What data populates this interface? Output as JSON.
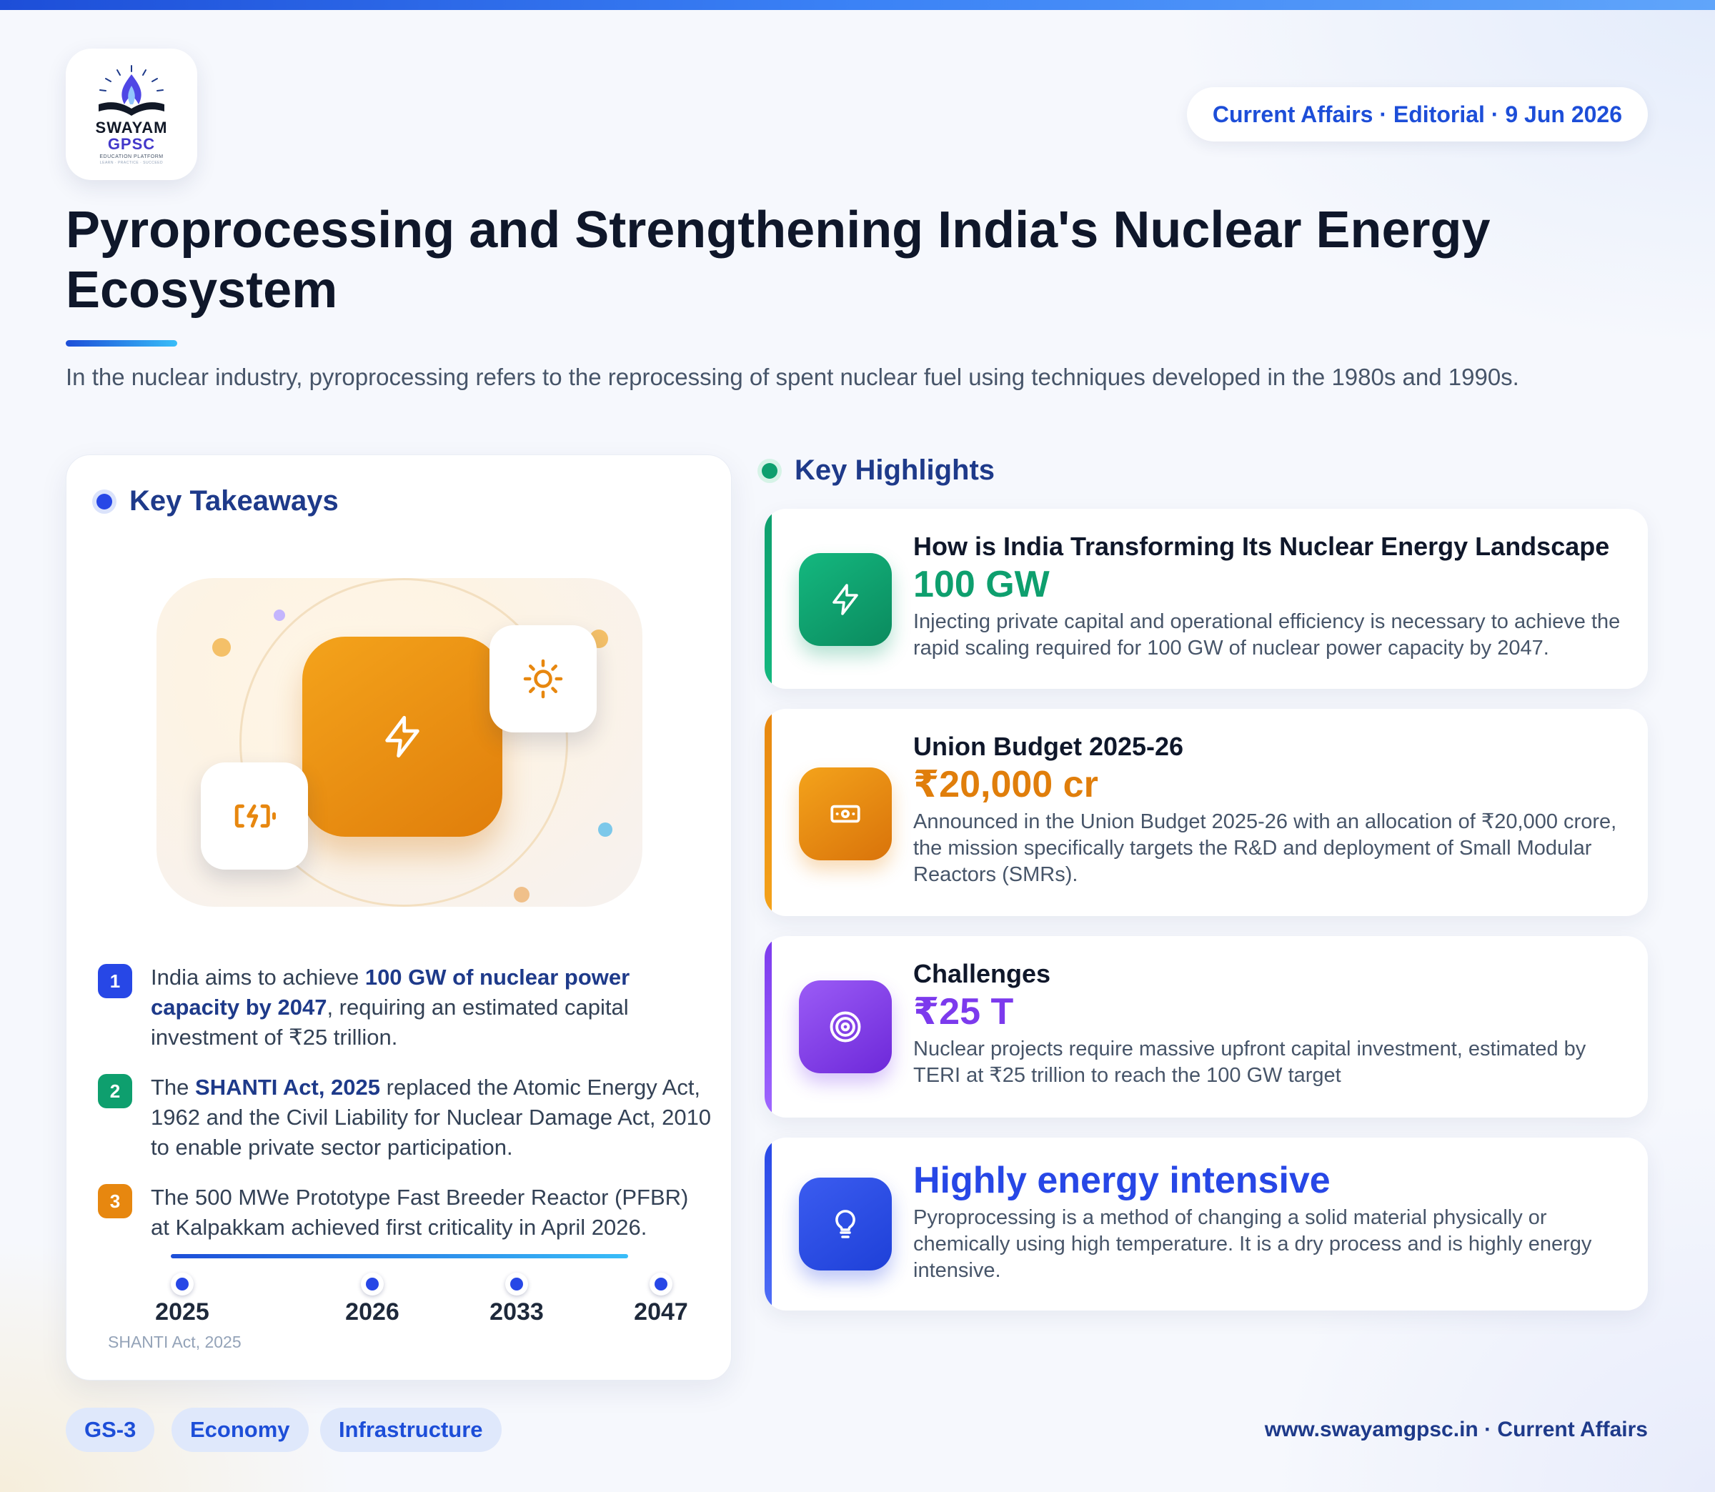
{
  "header": {
    "logo": {
      "line1": "SWAYAM",
      "line2": "GPSC",
      "line3": "EDUCATION PLATFORM",
      "line4": "LEARN · PRACTICE · SUCCEED"
    },
    "date_label": "Current Affairs · Editorial · 9 Jun 2026",
    "title": "Pyroprocessing and Strengthening India's Nuclear Energy Ecosystem",
    "intro": "In the nuclear industry, pyroprocessing refers to the reprocessing of spent nuclear fuel using techniques developed in the 1980s and 1990s."
  },
  "colors": {
    "blue": "#2747e6",
    "green": "#0e9f6e",
    "orange": "#e7870f",
    "purple": "#7c3aed",
    "navy": "#1e3a8a"
  },
  "takeaways": {
    "heading": "Key Takeaways",
    "icons": [
      "lightning-icon",
      "sun-icon",
      "battery-charging-icon"
    ],
    "items": [
      {
        "num": "1",
        "pre": "India aims to achieve ",
        "bold": "100 GW of nuclear power capacity by 2047",
        "post": ", requiring an estimated capital investment of ₹25 trillion."
      },
      {
        "num": "2",
        "pre": "The ",
        "bold": "SHANTI Act, 2025",
        "post": " replaced the Atomic Energy Act, 1962 and the Civil Liability for Nuclear Damage Act, 2010 to enable private sector participation."
      },
      {
        "num": "3",
        "pre": "The 500 MWe Prototype Fast Breeder Reactor (PFBR) at Kalpakkam achieved first criticality in April 2026.",
        "bold": "",
        "post": ""
      }
    ],
    "timeline": {
      "years": [
        "2025",
        "2026",
        "2033",
        "2047"
      ],
      "caption": "SHANTI Act, 2025"
    }
  },
  "highlights": {
    "heading": "Key Highlights",
    "cards": [
      {
        "icon": "lightning-icon",
        "heading": "How is India Transforming Its Nuclear Energy Landscape",
        "value": "100 GW",
        "desc": "Injecting private capital and operational efficiency is necessary to achieve the rapid scaling required for 100 GW of nuclear power capacity by 2047."
      },
      {
        "icon": "banknote-icon",
        "heading": "Union Budget 2025-26",
        "value": "₹20,000 cr",
        "desc": "Announced in the Union Budget 2025-26 with an allocation of ₹20,000 crore, the mission specifically targets the R&D and deployment of Small Modular Reactors (SMRs)."
      },
      {
        "icon": "target-icon",
        "heading": "Challenges",
        "value": "₹25 T",
        "desc": "Nuclear projects require massive upfront capital investment, estimated by TERI at ₹25 trillion to reach the 100 GW target"
      },
      {
        "icon": "lightbulb-icon",
        "heading": "",
        "value": "Highly energy intensive",
        "desc": "Pyroprocessing is a method of changing a solid material physically or chemically using high temperature. It is a dry process and is highly energy intensive."
      }
    ]
  },
  "tags": [
    "GS-3",
    "Economy",
    "Infrastructure"
  ],
  "footer": "www.swayamgpsc.in · Current Affairs"
}
